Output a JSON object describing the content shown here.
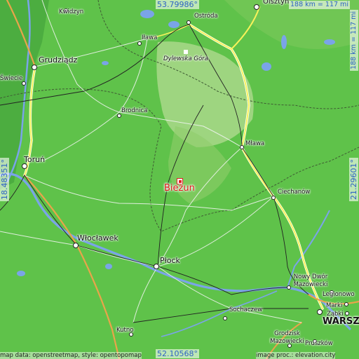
{
  "map": {
    "town": "Bieżun",
    "colors": {
      "lowland": "#5fc24a",
      "upland": "#a9d889",
      "river": "#7aa4e8",
      "road": "#f7f25a",
      "road_edge": "#ffffff",
      "border": "#3f5b33",
      "town": "#e01818",
      "coord_text": "#2e63c4"
    },
    "coordinates": {
      "top": "53.79986°",
      "bottom": "52.10568°",
      "left": "18.48351°",
      "right": "21.29601°"
    },
    "scale": {
      "horizontal": "188 km = 117 mi",
      "vertical": "188 km = 117 mi"
    },
    "attribution": {
      "left": "map data: openstreetmap, style: opentopomap",
      "right": "image proc.: elevation.city"
    },
    "places": [
      {
        "name": "Kwidzyn",
        "icon": "city-marker-icon"
      },
      {
        "name": "Ostróda",
        "icon": "city-marker-icon"
      },
      {
        "name": "Olsztyn",
        "icon": "city-marker-icon"
      },
      {
        "name": "Iława",
        "icon": "city-marker-icon"
      },
      {
        "name": "Dylewska Góra",
        "icon": "peak-icon"
      },
      {
        "name": "Grudziądz",
        "icon": "city-marker-icon"
      },
      {
        "name": "Świecie",
        "icon": "city-marker-icon"
      },
      {
        "name": "Brodnica",
        "icon": "city-marker-icon"
      },
      {
        "name": "Mława",
        "icon": "city-marker-icon"
      },
      {
        "name": "Toruń",
        "icon": "city-marker-icon"
      },
      {
        "name": "Ciechanów",
        "icon": "city-marker-icon"
      },
      {
        "name": "Włocławek",
        "icon": "city-marker-icon"
      },
      {
        "name": "Płock",
        "icon": "city-marker-icon"
      },
      {
        "name": "Nowy Dwór Mazowiecki",
        "icon": "city-marker-icon"
      },
      {
        "name": "Legionowo",
        "icon": "city-marker-icon"
      },
      {
        "name": "Marki",
        "icon": "city-marker-icon"
      },
      {
        "name": "Ząbki",
        "icon": "city-marker-icon"
      },
      {
        "name": "WARSZ",
        "icon": "city-marker-icon"
      },
      {
        "name": "Sochaczew",
        "icon": "city-marker-icon"
      },
      {
        "name": "Kutno",
        "icon": "city-marker-icon"
      },
      {
        "name": "Grodzisk Mazowiecki",
        "icon": "city-marker-icon"
      },
      {
        "name": "Pruszków",
        "icon": "city-marker-icon"
      }
    ]
  }
}
